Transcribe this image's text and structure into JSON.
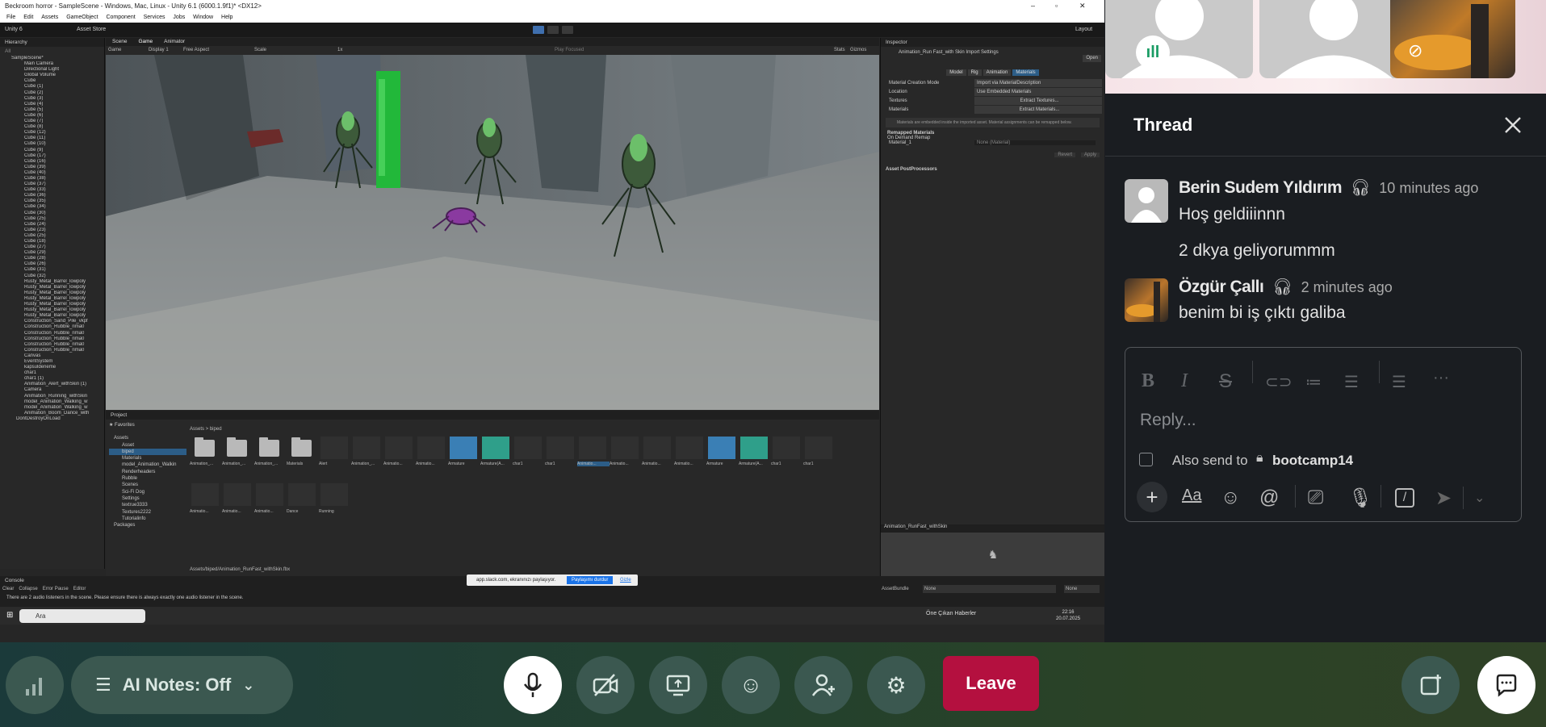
{
  "unity": {
    "window_title": "Beckroom horror - SampleScene - Windows, Mac, Linux - Unity 6.1 (6000.1.9f1)* <DX12>",
    "menu": [
      "File",
      "Edit",
      "Assets",
      "GameObject",
      "Component",
      "Services",
      "Jobs",
      "Window",
      "Help"
    ],
    "toolbar_left": "Unity 6",
    "toolbar_asset_store": "Asset Store",
    "toolbar_layout": "Layout",
    "hierarchy_title": "Hierarchy",
    "hierarchy_search": "All",
    "hierarchy_items": [
      "SampleScene*",
      "Main Camera",
      "Directional Light",
      "Global Volume",
      "Cube",
      "Cube (1)",
      "Cube (2)",
      "Cube (3)",
      "Cube (4)",
      "Cube (5)",
      "Cube (6)",
      "Cube (7)",
      "Cube (8)",
      "Cube (12)",
      "Cube (11)",
      "Cube (10)",
      "Cube (9)",
      "Cube (17)",
      "Cube (16)",
      "Cube (39)",
      "Cube (40)",
      "Cube (38)",
      "Cube (37)",
      "Cube (33)",
      "Cube (36)",
      "Cube (35)",
      "Cube (34)",
      "Cube (30)",
      "Cube (25)",
      "Cube (24)",
      "Cube (23)",
      "Cube (25)",
      "Cube (18)",
      "Cube (27)",
      "Cube (29)",
      "Cube (28)",
      "Cube (26)",
      "Cube (31)",
      "Cube (32)",
      "Rusty_Metal_Barrel_lowpoly",
      "Rusty_Metal_Barrel_lowpoly",
      "Rusty_Metal_Barrel_lowpoly",
      "Rusty_Metal_Barrel_lowpoly",
      "Rusty_Metal_Barrel_lowpoly",
      "Rusty_Metal_Barrel_lowpoly",
      "Rusty_Metal_Barrel_lowpoly",
      "Construction_Sand_Pile_vkpf",
      "Construction_Rubble_rima0",
      "Construction_Rubble_rima0",
      "Construction_Rubble_rima0",
      "Construction_Rubble_rima0",
      "Construction_Rubble_rima0",
      "Canvas",
      "EventSystem",
      "kapsuldeneme",
      "char1",
      "char1 (1)",
      "Animation_Alert_withSkin (1)",
      "Camera",
      "Animation_Running_withSkin",
      "model_Animation_Walking_w",
      "model_Animation_Walking_w",
      "Animation_Boom_Dance_with",
      "DontDestroyOnLoad"
    ],
    "scene_tabs": [
      "Scene",
      "Game",
      "Animator"
    ],
    "game_bar": [
      "Game",
      "Display 1",
      "Free Aspect",
      "Scale",
      "1x",
      "Play Focused",
      "Stats",
      "Gizmos"
    ],
    "project_title": "Project",
    "breadcrumb": "Assets > biped",
    "favorites": "Favorites",
    "assets_tree": [
      "Assets",
      "Asset",
      "biped",
      "Materials",
      "model_Animation_Walkin",
      "Renderheaders",
      "Rubble",
      "Scenes",
      "Sci-Fi Dog",
      "Settings",
      "textrue3333",
      "Textures2222",
      "Tutorialinfo",
      "Packages"
    ],
    "asset_row1": [
      "Animation_...",
      "Animation_...",
      "Animation_...",
      "Materials",
      "Alert",
      "Animation_...",
      "Animatio...",
      "Animatio...",
      "Armature",
      "Armature(A...",
      "char1",
      "char1",
      "Animatio...",
      "Animatio...",
      "Animatio...",
      "Animatio...",
      "Armature",
      "Armature(A...",
      "char1",
      "char1"
    ],
    "asset_row2": [
      "Animatio...",
      "Animatio...",
      "Animatio...",
      "Dance",
      "Running"
    ],
    "asset_path": "Assets/biped/Animation_RunFast_withSkin.fbx",
    "inspector_title": "Inspector",
    "inspector_header": "Animation_Run Fast_with Skin Import Settings",
    "inspector_open": "Open",
    "inspector_tabs": [
      "Model",
      "Rig",
      "Animation",
      "Materials"
    ],
    "inspector_rows": [
      {
        "label": "Material Creation Mode",
        "value": "Import via MaterialDescription"
      },
      {
        "label": "Location",
        "value": "Use Embedded Materials"
      },
      {
        "label": "Textures",
        "value": "Extract Textures..."
      },
      {
        "label": "Materials",
        "value": "Extract Materials..."
      }
    ],
    "inspector_info": "Materials are embedded inside the imported asset. Material assignments can be remapped below.",
    "remapped": "Remapped Materials",
    "on_demand": "On Demand Remap",
    "material_1_label": "Material_1",
    "material_1_value": "None (Material)",
    "revert": "Revert",
    "apply": "Apply",
    "postprocessors": "Asset PostProcessors",
    "preview_title": "Animation_RunFast_withSkin",
    "assetbundle_label": "AssetBundle",
    "assetbundle_value": "None",
    "assetbundle_variant": "None",
    "console_title": "Console",
    "console_buttons": [
      "Clear",
      "Collapse",
      "Error Pause",
      "Editor"
    ],
    "console_message": "There are 2 audio listeners in the scene. Please ensure there is always exactly one audio listener in the scene.",
    "share_notice": "app.slack.com, ekranınızı paylaşıyor.",
    "share_stop": "Paylaşımı durdur",
    "share_hide": "Gizle",
    "taskbar_search": "Ara",
    "taskbar_news": "Öne Çıkan Haberler",
    "taskbar_time": "22:16",
    "taskbar_date": "20.07.2025"
  },
  "thread": {
    "title": "Thread",
    "messages": [
      {
        "author": "Berin Sudem Yıldırım",
        "time": "10 minutes ago",
        "lines": [
          "Hoş geldiiinnn",
          "2 dkya geliyorummm"
        ]
      },
      {
        "author": "Özgür Çallı",
        "time": "2 minutes ago",
        "lines": [
          "benim bi iş çıktı galiba"
        ]
      }
    ],
    "reply_placeholder": "Reply...",
    "also_send_label": "Also send to",
    "channel": "bootcamp14"
  },
  "callbar": {
    "ai_notes": "AI Notes: Off",
    "leave": "Leave"
  },
  "colors": {
    "leave_bg": "#b4103f",
    "accent": "#2f7de0"
  }
}
